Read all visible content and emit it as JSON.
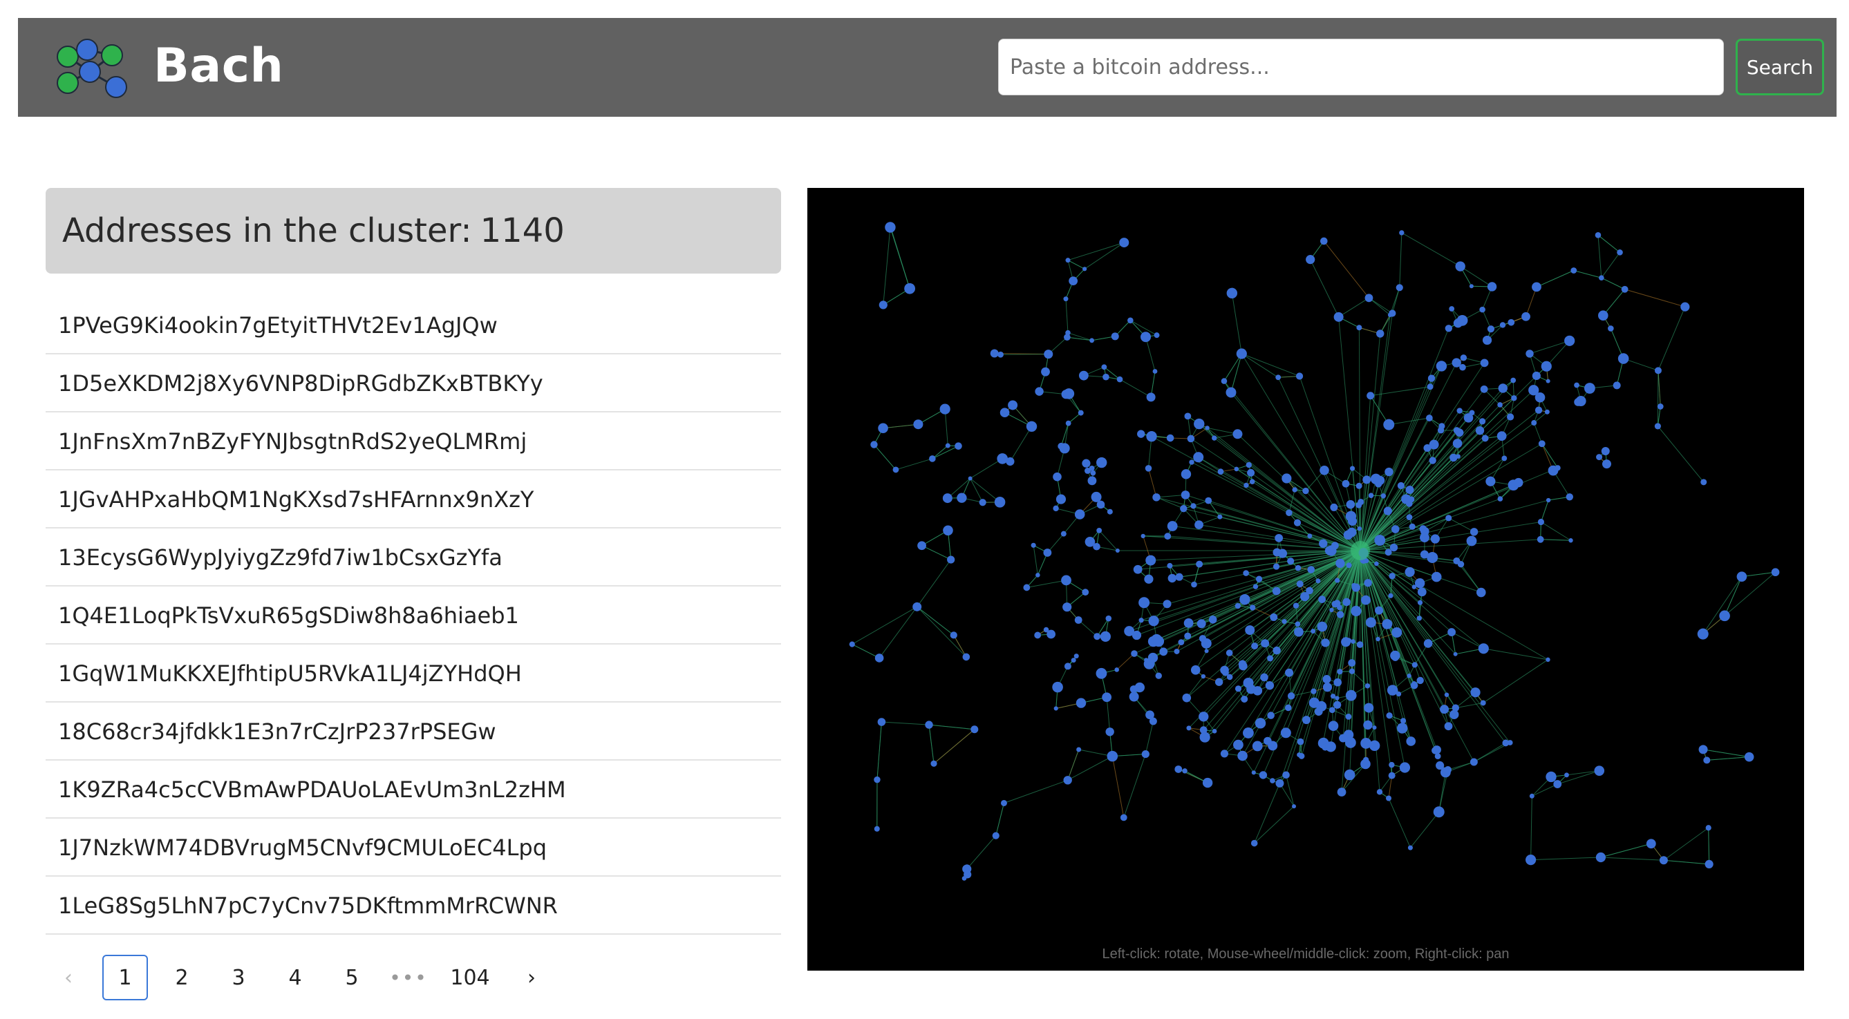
{
  "app": {
    "title": "Bach",
    "logo_icon": "cluster-graph-logo-icon"
  },
  "search": {
    "placeholder": "Paste a bitcoin address...",
    "value": "",
    "button_label": "Search",
    "button_border_color": "#2fb24c"
  },
  "cluster": {
    "label": "Addresses in the cluster:",
    "count": "1140"
  },
  "addresses": [
    "1PVeG9Ki4ookin7gEtyitTHVt2Ev1AgJQw",
    "1D5eXKDM2j8Xy6VNP8DipRGdbZKxBTBKYy",
    "1JnFnsXm7nBZyFYNJbsgtnRdS2yeQLMRmj",
    "1JGvAHPxaHbQM1NgKXsd7sHFArnnx9nXzY",
    "13EcysG6WypJyiygZz9fd7iw1bCsxGzYfa",
    "1Q4E1LoqPkTsVxuR65gSDiw8h8a6hiaeb1",
    "1GqW1MuKKXEJfhtipU5RVkA1LJ4jZYHdQH",
    "18C68cr34jfdkk1E3n7rCzJrP237rPSEGw",
    "1K9ZRa4c5cCVBmAwPDAUoLAEvUm3nL2zHM",
    "1J7NzkWM74DBVrugM5CNvf9CMULoEC4Lpq",
    "1LeG8Sg5LhN7pC7yCnv75DKftmmMrRCWNR"
  ],
  "pagination": {
    "prev_icon": "chevron-left-icon",
    "next_icon": "chevron-right-icon",
    "prev_symbol": "‹",
    "next_symbol": "›",
    "pages": [
      "1",
      "2",
      "3",
      "4",
      "5"
    ],
    "active_page": "1",
    "ellipsis": "•••",
    "last_page": "104"
  },
  "graph": {
    "hint": "Left-click: rotate, Mouse-wheel/middle-click: zoom, Right-click: pan",
    "background": "#000000",
    "node_color": "#3b6fd6",
    "edge_color": "#2f9e6a",
    "edge_color_alt": "#b07a2a"
  }
}
